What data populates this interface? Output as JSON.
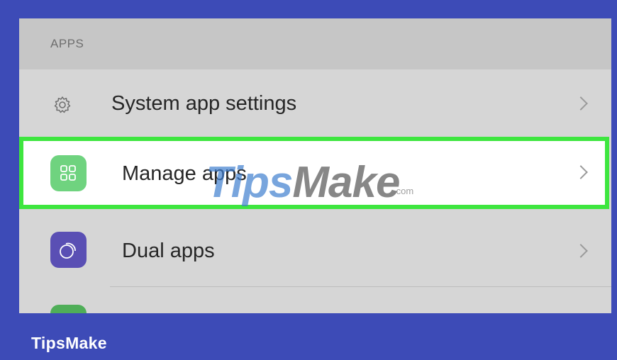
{
  "section": {
    "header": "APPS"
  },
  "rows": {
    "system": {
      "label": "System app settings",
      "icon": "gear-icon"
    },
    "manage": {
      "label": "Manage apps",
      "icon": "grid-icon",
      "highlighted": true,
      "highlight_color": "#3ee63f"
    },
    "dual": {
      "label": "Dual apps",
      "icon": "dual-apps-icon"
    }
  },
  "watermark": {
    "tips": "Tips",
    "make": "Make",
    "com": ".com"
  },
  "footer": {
    "logo": "TipsMake"
  },
  "colors": {
    "frame": "#3d4bb7",
    "screen_bg": "#d6d6d6",
    "header_bg": "#c6c6c6",
    "manage_icon": "#6fd37f",
    "dual_icon": "#5a4fb4",
    "next_icon": "#4fae58"
  }
}
